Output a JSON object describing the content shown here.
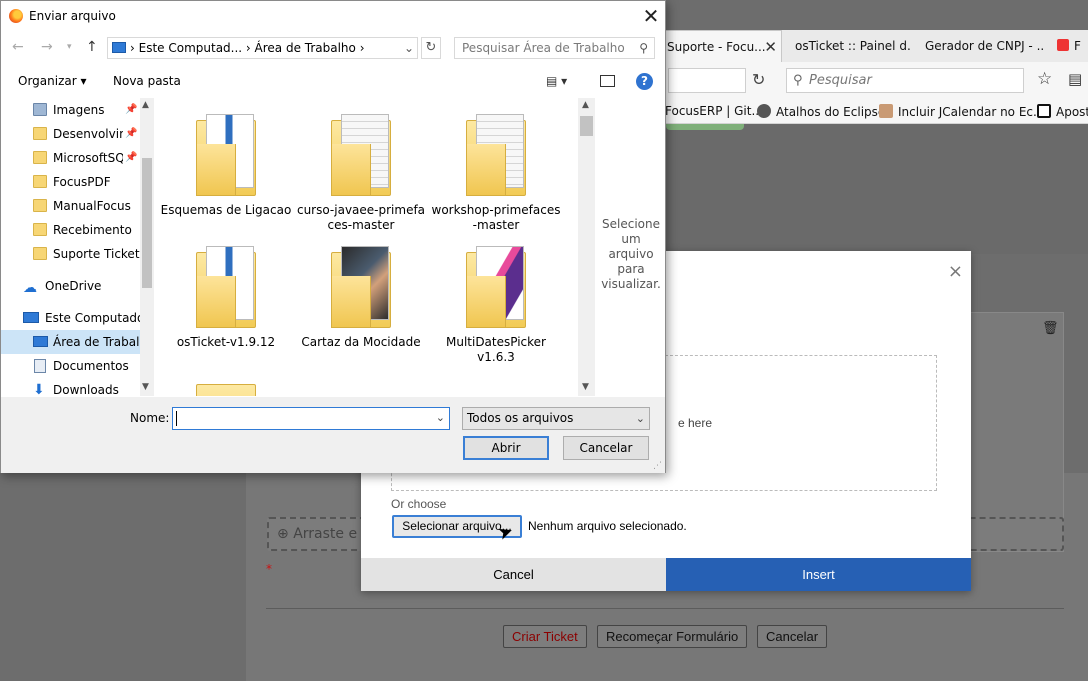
{
  "browser": {
    "tabs": [
      {
        "label": "Suporte - Focu...",
        "close": "✕"
      },
      {
        "label": "osTicket :: Painel d..."
      },
      {
        "label": "Gerador de CNPJ - ..."
      },
      {
        "label": "F"
      }
    ],
    "search_placeholder": "Pesquisar",
    "bookmarks": [
      {
        "label": "FocusERP | Git..."
      },
      {
        "label": "Atalhos do Eclipse"
      },
      {
        "label": "Incluir JCalendar no Ec..."
      },
      {
        "label": "Apost"
      }
    ]
  },
  "page": {
    "attach_placeholder": "Arraste e so",
    "required_marker": "*",
    "buttons": {
      "criar": "Criar Ticket",
      "recomecar": "Recomeçar Formulário",
      "cancelar": "Cancelar"
    }
  },
  "insert_modal": {
    "close": "×",
    "drop_text": "e here",
    "or_choose": "Or choose",
    "select_button": "Selecionar arquivo...",
    "no_file": "Nenhum arquivo selecionado.",
    "cancel": "Cancel",
    "insert": "Insert"
  },
  "file_dialog": {
    "title": "Enviar arquivo",
    "close": "✕",
    "breadcrumb": "›  Este Computad...  ›  Área de Trabalho  ›",
    "search_placeholder": "Pesquisar Área de Trabalho",
    "toolbar": {
      "organizar": "Organizar ▾",
      "nova_pasta": "Nova pasta"
    },
    "nav_items": [
      {
        "label": "Imagens",
        "pinned": true
      },
      {
        "label": "Desenvolvim",
        "pinned": true
      },
      {
        "label": "MicrosoftSQL",
        "pinned": true
      },
      {
        "label": "FocusPDF"
      },
      {
        "label": "ManualFocus"
      },
      {
        "label": "Recebimento"
      },
      {
        "label": "Suporte Ticket"
      },
      {
        "label": "OneDrive"
      },
      {
        "label": "Este Computador"
      },
      {
        "label": "Área de Trabalho"
      },
      {
        "label": "Documentos"
      },
      {
        "label": "Downloads"
      }
    ],
    "files": [
      {
        "label": "Esquemas de Ligacao",
        "thumb": "doc"
      },
      {
        "label": "curso-javaee-primefaces-master",
        "thumb": "lines"
      },
      {
        "label": "workshop-primefaces-master",
        "thumb": "lines"
      },
      {
        "label": "osTicket-v1.9.12",
        "thumb": "doc"
      },
      {
        "label": "Cartaz da Mocidade",
        "thumb": "photo"
      },
      {
        "label": "MultiDatesPicker v1.6.3",
        "thumb": "pink"
      }
    ],
    "preview_text": "Selecione um arquivo para visualizar.",
    "name_label": "Nome:",
    "name_value": "",
    "filter": "Todos os arquivos",
    "open": "Abrir",
    "cancel": "Cancelar"
  }
}
